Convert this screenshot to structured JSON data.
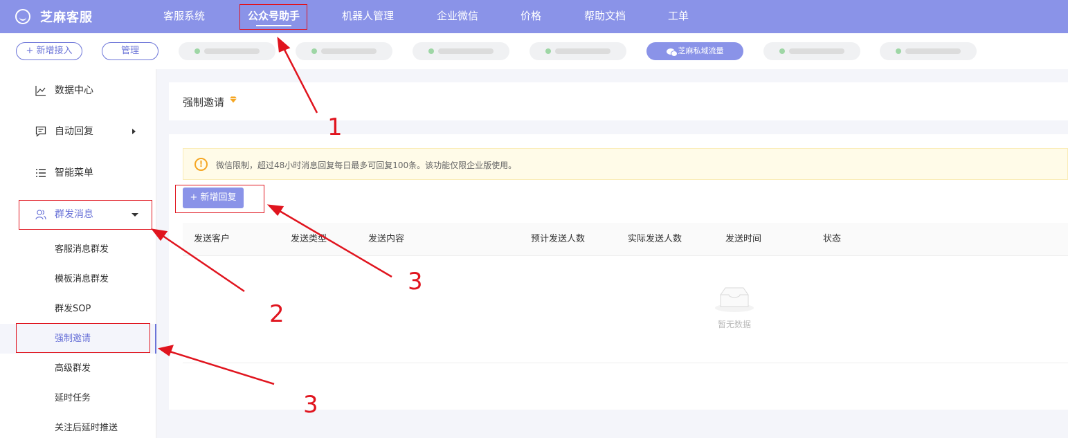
{
  "brand": {
    "name": "芝麻客服"
  },
  "topnav": [
    {
      "label": "客服系统"
    },
    {
      "label": "公众号助手",
      "active": true
    },
    {
      "label": "机器人管理"
    },
    {
      "label": "企业微信"
    },
    {
      "label": "价格"
    },
    {
      "label": "帮助文档"
    },
    {
      "label": "工单"
    }
  ],
  "account_bar": {
    "add_label": "+ 新增接入",
    "manage_label": "管理",
    "active_account": "芝麻私域流量"
  },
  "sidebar": {
    "items": [
      {
        "label": "数据中心",
        "icon": "line-chart-icon"
      },
      {
        "label": "自动回复",
        "icon": "message-icon"
      },
      {
        "label": "智能菜单",
        "icon": "list-icon"
      },
      {
        "label": "群发消息",
        "icon": "users-icon"
      }
    ],
    "sub_items": [
      {
        "label": "客服消息群发"
      },
      {
        "label": "模板消息群发"
      },
      {
        "label": "群发SOP"
      },
      {
        "label": "强制邀请",
        "active": true
      },
      {
        "label": "高级群发"
      },
      {
        "label": "延时任务"
      },
      {
        "label": "关注后延时推送"
      }
    ]
  },
  "main": {
    "title": "强制邀请",
    "notice": "微信限制，超过48小时消息回复每日最多可回复100条。该功能仅限企业版使用。",
    "add_button": "+ 新增回复",
    "columns": [
      "发送客户",
      "发送类型",
      "发送内容",
      "预计发送人数",
      "实际发送人数",
      "发送时间",
      "状态"
    ],
    "empty_text": "暂无数据"
  },
  "annotations": {
    "n1": "1",
    "n2": "2",
    "n3a": "3",
    "n3b": "3"
  },
  "colors": {
    "primary": "#8a93e8",
    "accent": "#6b74d8",
    "annotation": "#e0141e",
    "warning": "#f5a623"
  }
}
